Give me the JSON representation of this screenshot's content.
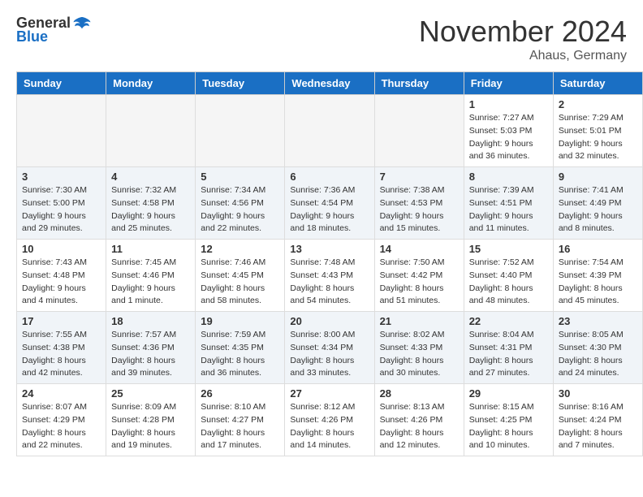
{
  "header": {
    "logo_general": "General",
    "logo_blue": "Blue",
    "month_title": "November 2024",
    "location": "Ahaus, Germany"
  },
  "weekdays": [
    "Sunday",
    "Monday",
    "Tuesday",
    "Wednesday",
    "Thursday",
    "Friday",
    "Saturday"
  ],
  "weeks": [
    [
      {
        "day": "",
        "empty": true
      },
      {
        "day": "",
        "empty": true
      },
      {
        "day": "",
        "empty": true
      },
      {
        "day": "",
        "empty": true
      },
      {
        "day": "",
        "empty": true
      },
      {
        "day": "1",
        "sunrise": "Sunrise: 7:27 AM",
        "sunset": "Sunset: 5:03 PM",
        "daylight": "Daylight: 9 hours and 36 minutes."
      },
      {
        "day": "2",
        "sunrise": "Sunrise: 7:29 AM",
        "sunset": "Sunset: 5:01 PM",
        "daylight": "Daylight: 9 hours and 32 minutes."
      }
    ],
    [
      {
        "day": "3",
        "sunrise": "Sunrise: 7:30 AM",
        "sunset": "Sunset: 5:00 PM",
        "daylight": "Daylight: 9 hours and 29 minutes."
      },
      {
        "day": "4",
        "sunrise": "Sunrise: 7:32 AM",
        "sunset": "Sunset: 4:58 PM",
        "daylight": "Daylight: 9 hours and 25 minutes."
      },
      {
        "day": "5",
        "sunrise": "Sunrise: 7:34 AM",
        "sunset": "Sunset: 4:56 PM",
        "daylight": "Daylight: 9 hours and 22 minutes."
      },
      {
        "day": "6",
        "sunrise": "Sunrise: 7:36 AM",
        "sunset": "Sunset: 4:54 PM",
        "daylight": "Daylight: 9 hours and 18 minutes."
      },
      {
        "day": "7",
        "sunrise": "Sunrise: 7:38 AM",
        "sunset": "Sunset: 4:53 PM",
        "daylight": "Daylight: 9 hours and 15 minutes."
      },
      {
        "day": "8",
        "sunrise": "Sunrise: 7:39 AM",
        "sunset": "Sunset: 4:51 PM",
        "daylight": "Daylight: 9 hours and 11 minutes."
      },
      {
        "day": "9",
        "sunrise": "Sunrise: 7:41 AM",
        "sunset": "Sunset: 4:49 PM",
        "daylight": "Daylight: 9 hours and 8 minutes."
      }
    ],
    [
      {
        "day": "10",
        "sunrise": "Sunrise: 7:43 AM",
        "sunset": "Sunset: 4:48 PM",
        "daylight": "Daylight: 9 hours and 4 minutes."
      },
      {
        "day": "11",
        "sunrise": "Sunrise: 7:45 AM",
        "sunset": "Sunset: 4:46 PM",
        "daylight": "Daylight: 9 hours and 1 minute."
      },
      {
        "day": "12",
        "sunrise": "Sunrise: 7:46 AM",
        "sunset": "Sunset: 4:45 PM",
        "daylight": "Daylight: 8 hours and 58 minutes."
      },
      {
        "day": "13",
        "sunrise": "Sunrise: 7:48 AM",
        "sunset": "Sunset: 4:43 PM",
        "daylight": "Daylight: 8 hours and 54 minutes."
      },
      {
        "day": "14",
        "sunrise": "Sunrise: 7:50 AM",
        "sunset": "Sunset: 4:42 PM",
        "daylight": "Daylight: 8 hours and 51 minutes."
      },
      {
        "day": "15",
        "sunrise": "Sunrise: 7:52 AM",
        "sunset": "Sunset: 4:40 PM",
        "daylight": "Daylight: 8 hours and 48 minutes."
      },
      {
        "day": "16",
        "sunrise": "Sunrise: 7:54 AM",
        "sunset": "Sunset: 4:39 PM",
        "daylight": "Daylight: 8 hours and 45 minutes."
      }
    ],
    [
      {
        "day": "17",
        "sunrise": "Sunrise: 7:55 AM",
        "sunset": "Sunset: 4:38 PM",
        "daylight": "Daylight: 8 hours and 42 minutes."
      },
      {
        "day": "18",
        "sunrise": "Sunrise: 7:57 AM",
        "sunset": "Sunset: 4:36 PM",
        "daylight": "Daylight: 8 hours and 39 minutes."
      },
      {
        "day": "19",
        "sunrise": "Sunrise: 7:59 AM",
        "sunset": "Sunset: 4:35 PM",
        "daylight": "Daylight: 8 hours and 36 minutes."
      },
      {
        "day": "20",
        "sunrise": "Sunrise: 8:00 AM",
        "sunset": "Sunset: 4:34 PM",
        "daylight": "Daylight: 8 hours and 33 minutes."
      },
      {
        "day": "21",
        "sunrise": "Sunrise: 8:02 AM",
        "sunset": "Sunset: 4:33 PM",
        "daylight": "Daylight: 8 hours and 30 minutes."
      },
      {
        "day": "22",
        "sunrise": "Sunrise: 8:04 AM",
        "sunset": "Sunset: 4:31 PM",
        "daylight": "Daylight: 8 hours and 27 minutes."
      },
      {
        "day": "23",
        "sunrise": "Sunrise: 8:05 AM",
        "sunset": "Sunset: 4:30 PM",
        "daylight": "Daylight: 8 hours and 24 minutes."
      }
    ],
    [
      {
        "day": "24",
        "sunrise": "Sunrise: 8:07 AM",
        "sunset": "Sunset: 4:29 PM",
        "daylight": "Daylight: 8 hours and 22 minutes."
      },
      {
        "day": "25",
        "sunrise": "Sunrise: 8:09 AM",
        "sunset": "Sunset: 4:28 PM",
        "daylight": "Daylight: 8 hours and 19 minutes."
      },
      {
        "day": "26",
        "sunrise": "Sunrise: 8:10 AM",
        "sunset": "Sunset: 4:27 PM",
        "daylight": "Daylight: 8 hours and 17 minutes."
      },
      {
        "day": "27",
        "sunrise": "Sunrise: 8:12 AM",
        "sunset": "Sunset: 4:26 PM",
        "daylight": "Daylight: 8 hours and 14 minutes."
      },
      {
        "day": "28",
        "sunrise": "Sunrise: 8:13 AM",
        "sunset": "Sunset: 4:26 PM",
        "daylight": "Daylight: 8 hours and 12 minutes."
      },
      {
        "day": "29",
        "sunrise": "Sunrise: 8:15 AM",
        "sunset": "Sunset: 4:25 PM",
        "daylight": "Daylight: 8 hours and 10 minutes."
      },
      {
        "day": "30",
        "sunrise": "Sunrise: 8:16 AM",
        "sunset": "Sunset: 4:24 PM",
        "daylight": "Daylight: 8 hours and 7 minutes."
      }
    ]
  ]
}
